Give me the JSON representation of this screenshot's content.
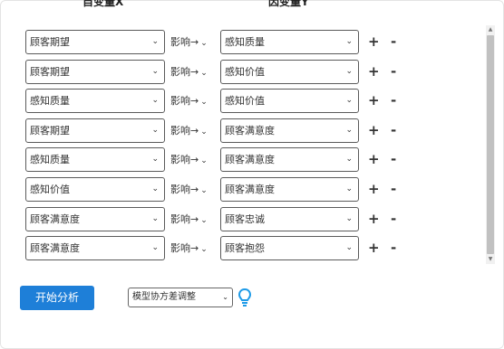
{
  "headers": {
    "x": "自变量X",
    "y": "因变量Y"
  },
  "chevron": "⌄",
  "rows": [
    {
      "x": "顾客期望",
      "rel": "影响→",
      "y": "感知质量"
    },
    {
      "x": "顾客期望",
      "rel": "影响→",
      "y": "感知价值"
    },
    {
      "x": "感知质量",
      "rel": "影响→",
      "y": "感知价值"
    },
    {
      "x": "顾客期望",
      "rel": "影响→",
      "y": "顾客满意度"
    },
    {
      "x": "感知质量",
      "rel": "影响→",
      "y": "顾客满意度"
    },
    {
      "x": "感知价值",
      "rel": "影响→",
      "y": "顾客满意度"
    },
    {
      "x": "顾客满意度",
      "rel": "影响→",
      "y": "顾客忠诚"
    },
    {
      "x": "顾客满意度",
      "rel": "影响→",
      "y": "顾客抱怨"
    }
  ],
  "row_actions": {
    "add": "+",
    "remove": "-"
  },
  "start_button": "开始分析",
  "method": {
    "selected": "模型协方差调整"
  },
  "colors": {
    "accent": "#1e7fd8",
    "bulb": "#1e9be8"
  },
  "icons": {
    "bulb": "lightbulb-icon",
    "chevron": "chevron-down-icon"
  }
}
